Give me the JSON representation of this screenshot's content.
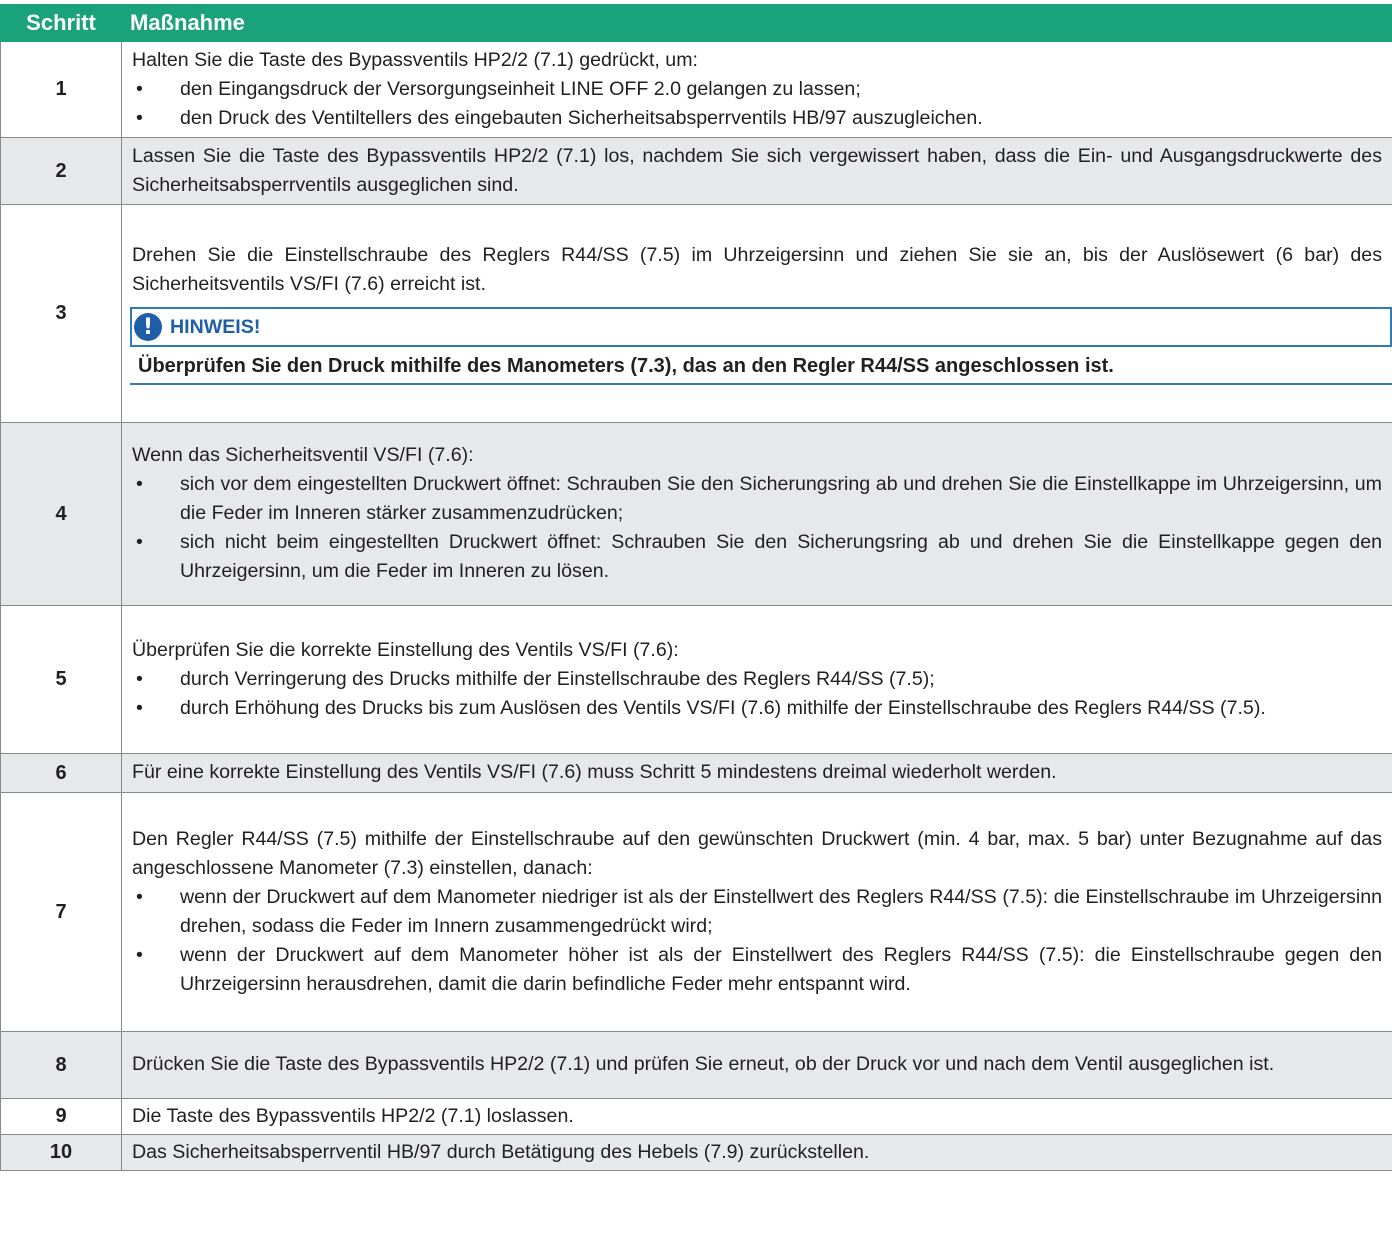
{
  "header": {
    "col_step": "Schritt",
    "col_action": "Maßnahme"
  },
  "bullet": "•",
  "rows": [
    {
      "num": "1",
      "intro": "Halten Sie die Taste des Bypassventils HP2/2 (7.1) gedrückt, um:",
      "bullets": [
        "den Eingangsdruck der Versorgungseinheit LINE OFF 2.0 gelangen zu lassen;",
        "den Druck des Ventiltellers des eingebauten Sicherheitsabsperrventils HB/97 auszugleichen."
      ]
    },
    {
      "num": "2",
      "intro": "Lassen Sie die Taste des Bypassventils HP2/2 (7.1) los, nachdem Sie sich vergewissert haben, dass die Ein- und Ausgangsdruckwerte des Sicherheitsabsperrventils ausgeglichen sind."
    },
    {
      "num": "3",
      "intro": "Drehen Sie die Einstellschraube des Reglers R44/SS (7.5) im Uhrzeigersinn und ziehen Sie sie an, bis der Auslösewert (6 bar) des Sicherheitsventils VS/FI (7.6) erreicht ist.",
      "notice_icon": "exclamation-icon",
      "notice_title": "HINWEIS!",
      "notice_text": "Überprüfen Sie den Druck mithilfe des Manometers (7.3), das an den Regler R44/SS angeschlossen ist."
    },
    {
      "num": "4",
      "intro": "Wenn das Sicherheitsventil VS/FI (7.6):",
      "bullets": [
        "sich vor dem eingestellten Druckwert öffnet: Schrauben Sie den Sicherungsring ab und drehen Sie die Einstellkappe im Uhrzeigersinn, um die Feder im Inneren stärker zusammenzudrücken;",
        "sich nicht beim eingestellten Druckwert öffnet: Schrauben Sie den Sicherungsring ab und drehen Sie die Einstellkappe gegen den Uhrzeigersinn, um die Feder im Inneren zu lösen."
      ]
    },
    {
      "num": "5",
      "intro": "Überprüfen Sie die korrekte Einstellung des Ventils VS/FI (7.6):",
      "bullets": [
        "durch Verringerung des Drucks mithilfe der Einstellschraube des Reglers R44/SS (7.5);",
        "durch Erhöhung des Drucks bis zum Auslösen des Ventils VS/FI (7.6) mithilfe der Einstellschraube des Reglers R44/SS (7.5)."
      ]
    },
    {
      "num": "6",
      "intro": "Für eine korrekte Einstellung des Ventils VS/FI (7.6) muss Schritt 5 mindestens dreimal wiederholt werden."
    },
    {
      "num": "7",
      "intro": "Den Regler R44/SS (7.5) mithilfe der Einstellschraube auf den gewünschten Druckwert (min. 4 bar, max. 5 bar) unter Bezugnahme auf das angeschlossene Manometer (7.3) einstellen, danach:",
      "bullets": [
        "wenn der Druckwert auf dem Manometer niedriger ist als der Einstellwert des Reglers R44/SS (7.5): die Einstellschraube im Uhrzeigersinn drehen, sodass die Feder im Innern zusammengedrückt wird;",
        "wenn der Druckwert auf dem Manometer höher ist als der Einstellwert des Reglers R44/SS (7.5): die Einstellschraube gegen den Uhrzeigersinn herausdrehen, damit die darin befindliche Feder mehr entspannt wird."
      ]
    },
    {
      "num": "8",
      "intro": "Drücken Sie die Taste des Bypassventils HP2/2 (7.1) und prüfen Sie erneut, ob der Druck vor und nach dem Ventil ausgeglichen ist."
    },
    {
      "num": "9",
      "intro": "Die Taste des Bypassventils HP2/2 (7.1) loslassen."
    },
    {
      "num": "10",
      "intro": "Das Sicherheitsabsperrventil HB/97 durch Betätigung des Hebels (7.9) zurückstellen."
    }
  ]
}
